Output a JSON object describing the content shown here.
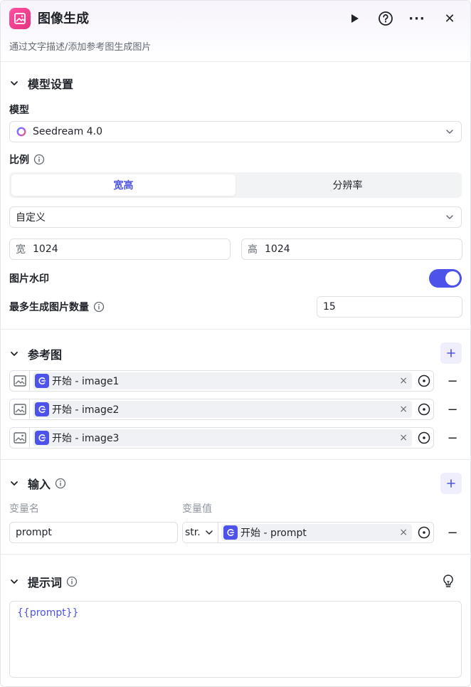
{
  "header": {
    "title": "图像生成",
    "subtitle": "通过文字描述/添加参考图生成图片",
    "more_glyph": "···",
    "close_glyph": "✕"
  },
  "model_section": {
    "title": "模型设置",
    "model_label": "模型",
    "model_value": "Seedream 4.0",
    "ratio_label": "比例",
    "tabs": [
      {
        "label": "宽高",
        "active": true
      },
      {
        "label": "分辨率",
        "active": false
      }
    ],
    "ratio_select": "自定义",
    "width_prefix": "宽",
    "width_value": "1024",
    "height_prefix": "高",
    "height_value": "1024",
    "watermark_label": "图片水印",
    "watermark_on": true,
    "max_images_label": "最多生成图片数量",
    "max_images_value": "15"
  },
  "reference_section": {
    "title": "参考图",
    "items": [
      {
        "source": "开始",
        "sep": " - ",
        "var": "image1"
      },
      {
        "source": "开始",
        "sep": " - ",
        "var": "image2"
      },
      {
        "source": "开始",
        "sep": " - ",
        "var": "image3"
      }
    ]
  },
  "input_section": {
    "title": "输入",
    "col_name": "变量名",
    "col_value": "变量值",
    "row": {
      "name": "prompt",
      "type": "str.",
      "source": "开始",
      "sep": " - ",
      "var": "prompt"
    }
  },
  "prompt_section": {
    "title": "提示词",
    "content": "{{prompt}}"
  },
  "colors": {
    "accent": "#4d53e8",
    "app_icon": "#e2357f"
  },
  "glyphs": {
    "remove": "×",
    "minus": "−"
  }
}
